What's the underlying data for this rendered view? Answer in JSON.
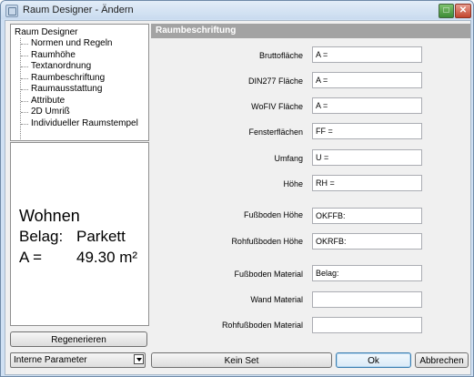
{
  "window": {
    "title": "Raum Designer - Ändern"
  },
  "tree": {
    "root": "Raum Designer",
    "items": [
      "Normen und Regeln",
      "Raumhöhe",
      "Textanordnung",
      "Raumbeschriftung",
      "Raumausstattung",
      "Attribute",
      "2D Umriß",
      "Individueller Raumstempel"
    ]
  },
  "preview": {
    "title": "Wohnen",
    "belag_label": "Belag:",
    "belag_value": "Parkett",
    "area_label": "A =",
    "area_value": "49.30 m²"
  },
  "buttons": {
    "regenerate": "Regenerieren",
    "kein_set": "Kein Set",
    "ok": "Ok",
    "cancel": "Abbrechen"
  },
  "param_select": {
    "value": "Interne Parameter"
  },
  "section": {
    "title": "Raumbeschriftung"
  },
  "fields": [
    {
      "label": "Bruttofläche",
      "value": "A ="
    },
    {
      "label": "DIN277 Fläche",
      "value": "A ="
    },
    {
      "label": "WoFIV Fläche",
      "value": "A ="
    },
    {
      "label": "Fensterflächen",
      "value": "FF ="
    },
    {
      "label": "Umfang",
      "value": "U ="
    },
    {
      "label": "Höhe",
      "value": "RH ="
    },
    {
      "label": "Fußboden Höhe",
      "value": "OKFFB:"
    },
    {
      "label": "Rohfußboden Höhe",
      "value": "OKRFB:"
    },
    {
      "label": "Fußboden Material",
      "value": "Belag:"
    },
    {
      "label": "Wand Material",
      "value": ""
    },
    {
      "label": "Rohfußboden Material",
      "value": ""
    }
  ]
}
